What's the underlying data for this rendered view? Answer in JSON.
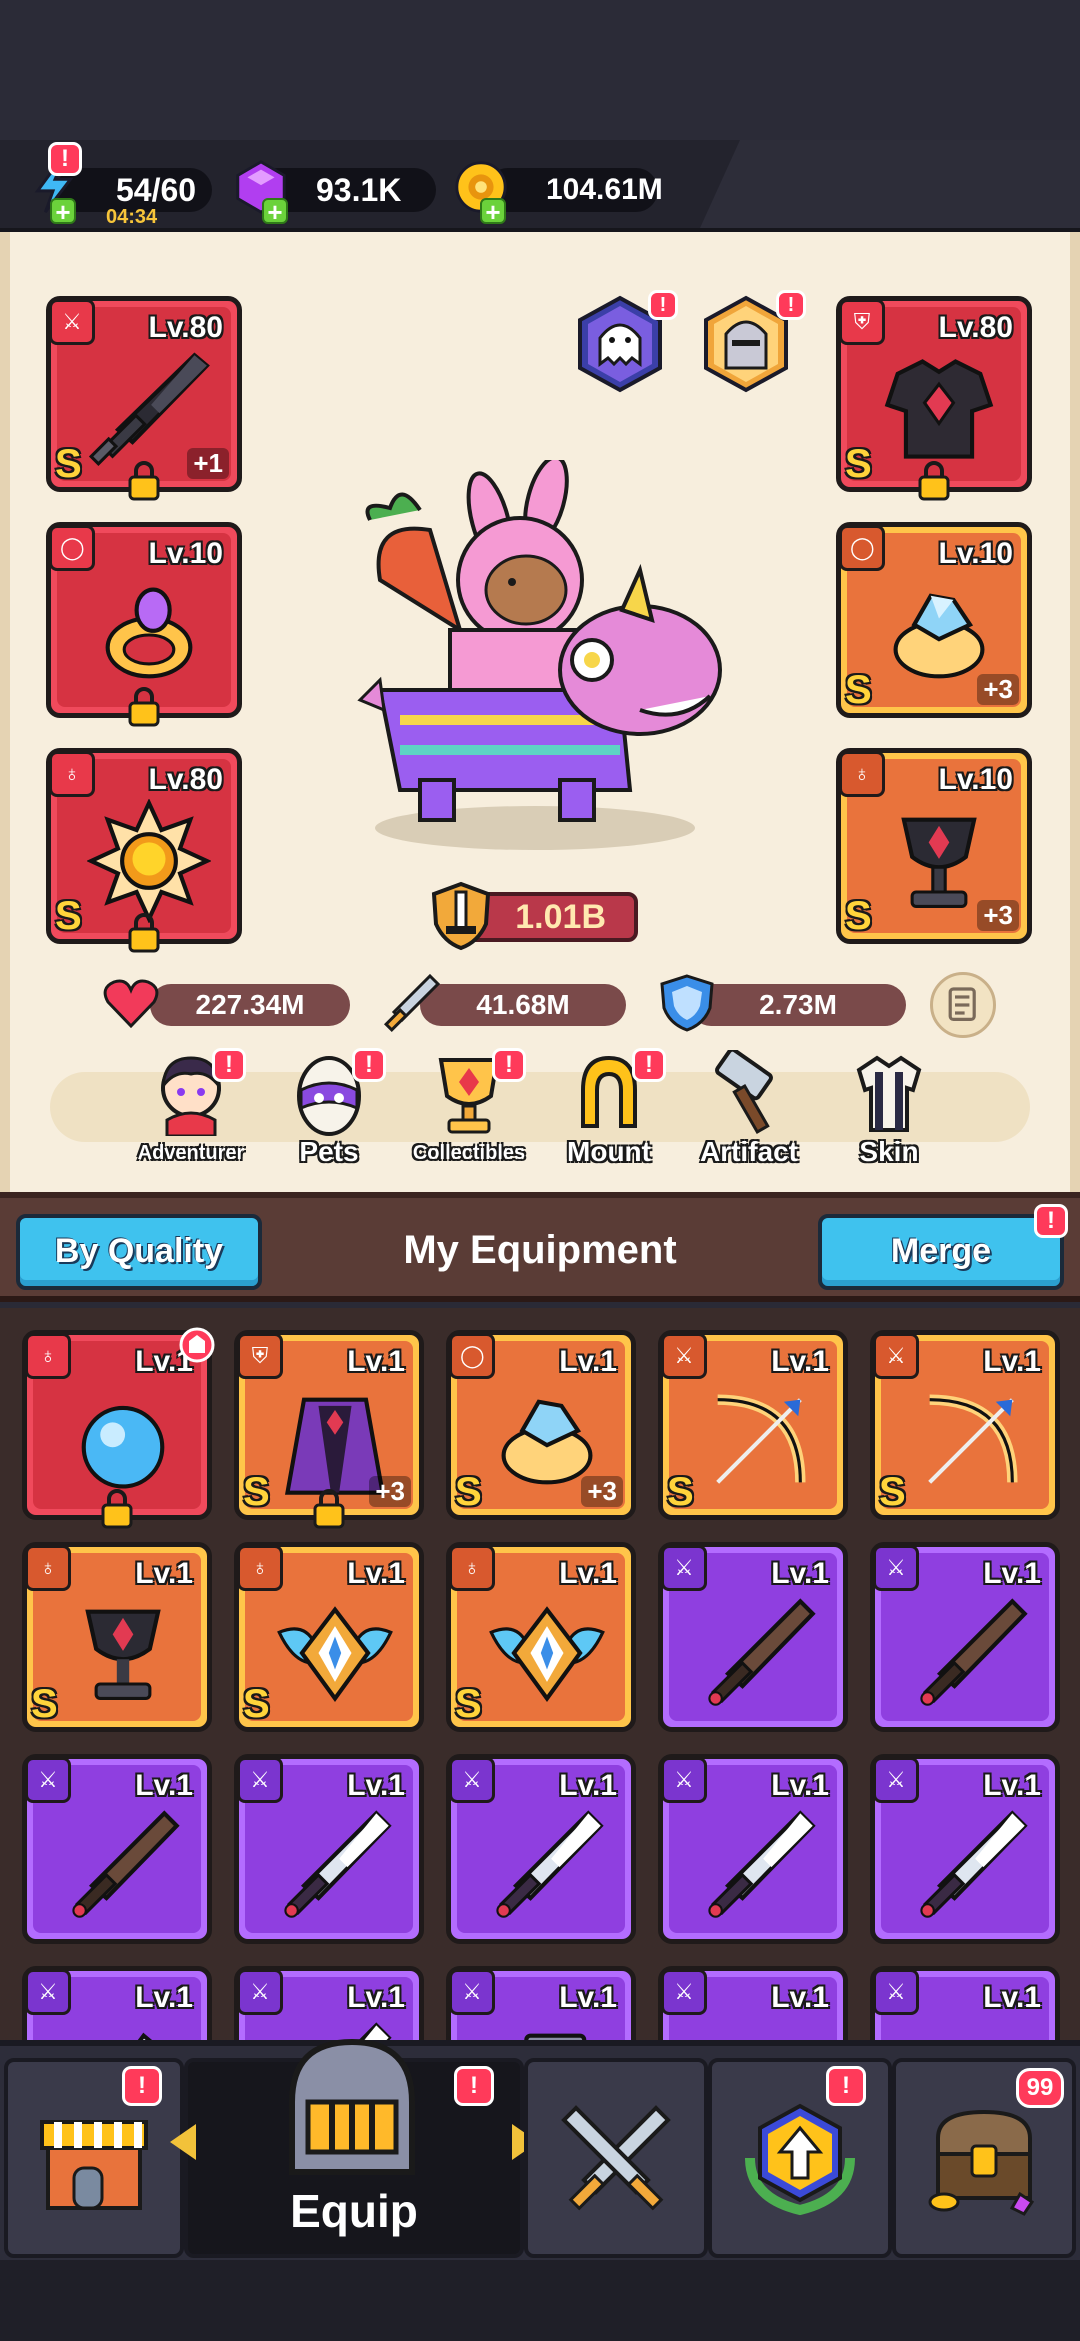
{
  "resources": {
    "energy": {
      "value": "54/60",
      "timer": "04:34",
      "icon": "lightning-icon"
    },
    "gems": {
      "value": "93.1K",
      "icon": "gem-icon"
    },
    "coins": {
      "value": "104.61M",
      "icon": "coin-icon"
    }
  },
  "alert_mark": "!",
  "equipped": {
    "left": [
      {
        "type": "weapon",
        "level": "Lv.80",
        "grade": "S",
        "bonus": "+1",
        "rarity": "red",
        "locked": true,
        "icon": "dark-sword-icon"
      },
      {
        "type": "ring",
        "level": "Lv.10",
        "grade": "",
        "bonus": "",
        "rarity": "red",
        "locked": true,
        "icon": "gold-ring-icon"
      },
      {
        "type": "necklace",
        "level": "Lv.80",
        "grade": "S",
        "bonus": "",
        "rarity": "red",
        "locked": true,
        "icon": "sun-amulet-icon"
      }
    ],
    "right": [
      {
        "type": "armor",
        "level": "Lv.80",
        "grade": "S",
        "bonus": "",
        "rarity": "red",
        "locked": true,
        "icon": "dark-armor-icon"
      },
      {
        "type": "ring",
        "level": "Lv.10",
        "grade": "S",
        "bonus": "+3",
        "rarity": "orange",
        "locked": false,
        "icon": "crystal-ring-icon"
      },
      {
        "type": "necklace",
        "level": "Lv.10",
        "grade": "S",
        "bonus": "+3",
        "rarity": "orange",
        "locked": false,
        "icon": "goblet-icon"
      }
    ]
  },
  "power": "1.01B",
  "stats": {
    "hp": "227.34M",
    "attack": "41.68M",
    "defense": "2.73M"
  },
  "nav": [
    {
      "label": "Adventurer",
      "icon": "adventurer-icon",
      "alert": true
    },
    {
      "label": "Pets",
      "icon": "pet-egg-icon",
      "alert": true
    },
    {
      "label": "Collectibles",
      "icon": "trophy-icon",
      "alert": true
    },
    {
      "label": "Mount",
      "icon": "horseshoe-icon",
      "alert": true
    },
    {
      "label": "Artifact",
      "icon": "hammer-icon",
      "alert": false
    },
    {
      "label": "Skin",
      "icon": "outfit-icon",
      "alert": false
    }
  ],
  "equipment_header": {
    "sort_button": "By Quality",
    "title": "My Equipment",
    "merge_button": "Merge"
  },
  "inventory": [
    {
      "type": "necklace",
      "level": "Lv.1",
      "grade": "",
      "bonus": "",
      "rarity": "red",
      "locked": true,
      "new": true,
      "icon": "blue-orb-icon"
    },
    {
      "type": "armor",
      "level": "Lv.1",
      "grade": "S",
      "bonus": "+3",
      "rarity": "orange",
      "locked": true,
      "new": false,
      "icon": "purple-cloak-icon"
    },
    {
      "type": "ring",
      "level": "Lv.1",
      "grade": "S",
      "bonus": "+3",
      "rarity": "orange",
      "locked": false,
      "new": false,
      "icon": "crystal-ring-icon"
    },
    {
      "type": "weapon",
      "level": "Lv.1",
      "grade": "S",
      "bonus": "",
      "rarity": "orange",
      "locked": false,
      "new": false,
      "icon": "golden-bow-icon"
    },
    {
      "type": "weapon",
      "level": "Lv.1",
      "grade": "S",
      "bonus": "",
      "rarity": "orange",
      "locked": false,
      "new": false,
      "icon": "golden-bow-icon"
    },
    {
      "type": "necklace",
      "level": "Lv.1",
      "grade": "S",
      "bonus": "",
      "rarity": "orange",
      "locked": false,
      "new": false,
      "icon": "goblet-icon"
    },
    {
      "type": "necklace",
      "level": "Lv.1",
      "grade": "S",
      "bonus": "",
      "rarity": "orange",
      "locked": false,
      "new": false,
      "icon": "winged-emblem-icon"
    },
    {
      "type": "necklace",
      "level": "Lv.1",
      "grade": "S",
      "bonus": "",
      "rarity": "orange",
      "locked": false,
      "new": false,
      "icon": "winged-emblem-icon"
    },
    {
      "type": "weapon",
      "level": "Lv.1",
      "grade": "",
      "bonus": "",
      "rarity": "purple",
      "locked": false,
      "new": false,
      "icon": "wooden-sword-icon"
    },
    {
      "type": "weapon",
      "level": "Lv.1",
      "grade": "",
      "bonus": "",
      "rarity": "purple",
      "locked": false,
      "new": false,
      "icon": "wooden-sword-icon"
    },
    {
      "type": "weapon",
      "level": "Lv.1",
      "grade": "",
      "bonus": "",
      "rarity": "purple",
      "locked": false,
      "new": false,
      "icon": "wooden-sword-icon"
    },
    {
      "type": "weapon",
      "level": "Lv.1",
      "grade": "",
      "bonus": "",
      "rarity": "purple",
      "locked": false,
      "new": false,
      "icon": "steel-sword-icon"
    },
    {
      "type": "weapon",
      "level": "Lv.1",
      "grade": "",
      "bonus": "",
      "rarity": "purple",
      "locked": false,
      "new": false,
      "icon": "steel-sword-icon"
    },
    {
      "type": "weapon",
      "level": "Lv.1",
      "grade": "",
      "bonus": "",
      "rarity": "purple",
      "locked": false,
      "new": false,
      "icon": "steel-sword-icon"
    },
    {
      "type": "weapon",
      "level": "Lv.1",
      "grade": "",
      "bonus": "",
      "rarity": "purple",
      "locked": false,
      "new": false,
      "icon": "steel-sword-icon"
    },
    {
      "type": "weapon",
      "level": "Lv.1",
      "grade": "",
      "bonus": "",
      "rarity": "purple",
      "locked": false,
      "new": false,
      "icon": "dagger-icon"
    },
    {
      "type": "weapon",
      "level": "Lv.1",
      "grade": "",
      "bonus": "",
      "rarity": "purple",
      "locked": false,
      "new": false,
      "icon": "steel-sword-icon"
    },
    {
      "type": "weapon",
      "level": "Lv.1",
      "grade": "",
      "bonus": "",
      "rarity": "purple",
      "locked": false,
      "new": false,
      "icon": "hammer-weapon-icon"
    },
    {
      "type": "weapon",
      "level": "Lv.1",
      "grade": "",
      "bonus": "",
      "rarity": "purple",
      "locked": false,
      "new": false,
      "icon": "bone-bow-icon"
    },
    {
      "type": "weapon",
      "level": "Lv.1",
      "grade": "",
      "bonus": "",
      "rarity": "purple",
      "locked": false,
      "new": false,
      "icon": "bone-bow-icon"
    }
  ],
  "bottom_nav": [
    {
      "label": "",
      "icon": "shop-icon",
      "alert": true,
      "count": ""
    },
    {
      "label": "Equip",
      "icon": "knight-helmet-icon",
      "alert": true,
      "count": ""
    },
    {
      "label": "",
      "icon": "crossed-swords-icon",
      "alert": false,
      "count": ""
    },
    {
      "label": "",
      "icon": "upgrade-emblem-icon",
      "alert": true,
      "count": ""
    },
    {
      "label": "",
      "icon": "treasure-chest-icon",
      "alert": false,
      "count": "99"
    }
  ],
  "colors": {
    "rarity_red": "#d63342",
    "rarity_orange": "#e9733c",
    "rarity_purple": "#8f3fe0",
    "grade_gold": "#ffd43b",
    "alert_red": "#ff3a5a",
    "button_blue": "#3fc2ee"
  }
}
